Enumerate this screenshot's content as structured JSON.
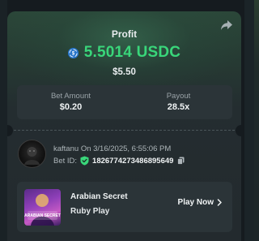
{
  "card": {
    "title": "Profit",
    "amount": "5.5014 USDC",
    "fiat_value": "$5.50",
    "coin_icon": "usdc-icon",
    "accent_color": "#39d67a"
  },
  "stats": {
    "bet_amount_label": "Bet Amount",
    "bet_amount_value": "$0.20",
    "payout_label": "Payout",
    "payout_value": "28.5x"
  },
  "bet_info": {
    "username": "kaftanu",
    "date_text": "On 3/16/2025, 6:55:06 PM",
    "bet_id_label": "Bet ID:",
    "bet_id_value": "1826774273486895649"
  },
  "game": {
    "name": "Arabian Secret",
    "provider": "Ruby Play",
    "play_label": "Play Now",
    "thumb_text": "ARABIAN SECRET"
  }
}
